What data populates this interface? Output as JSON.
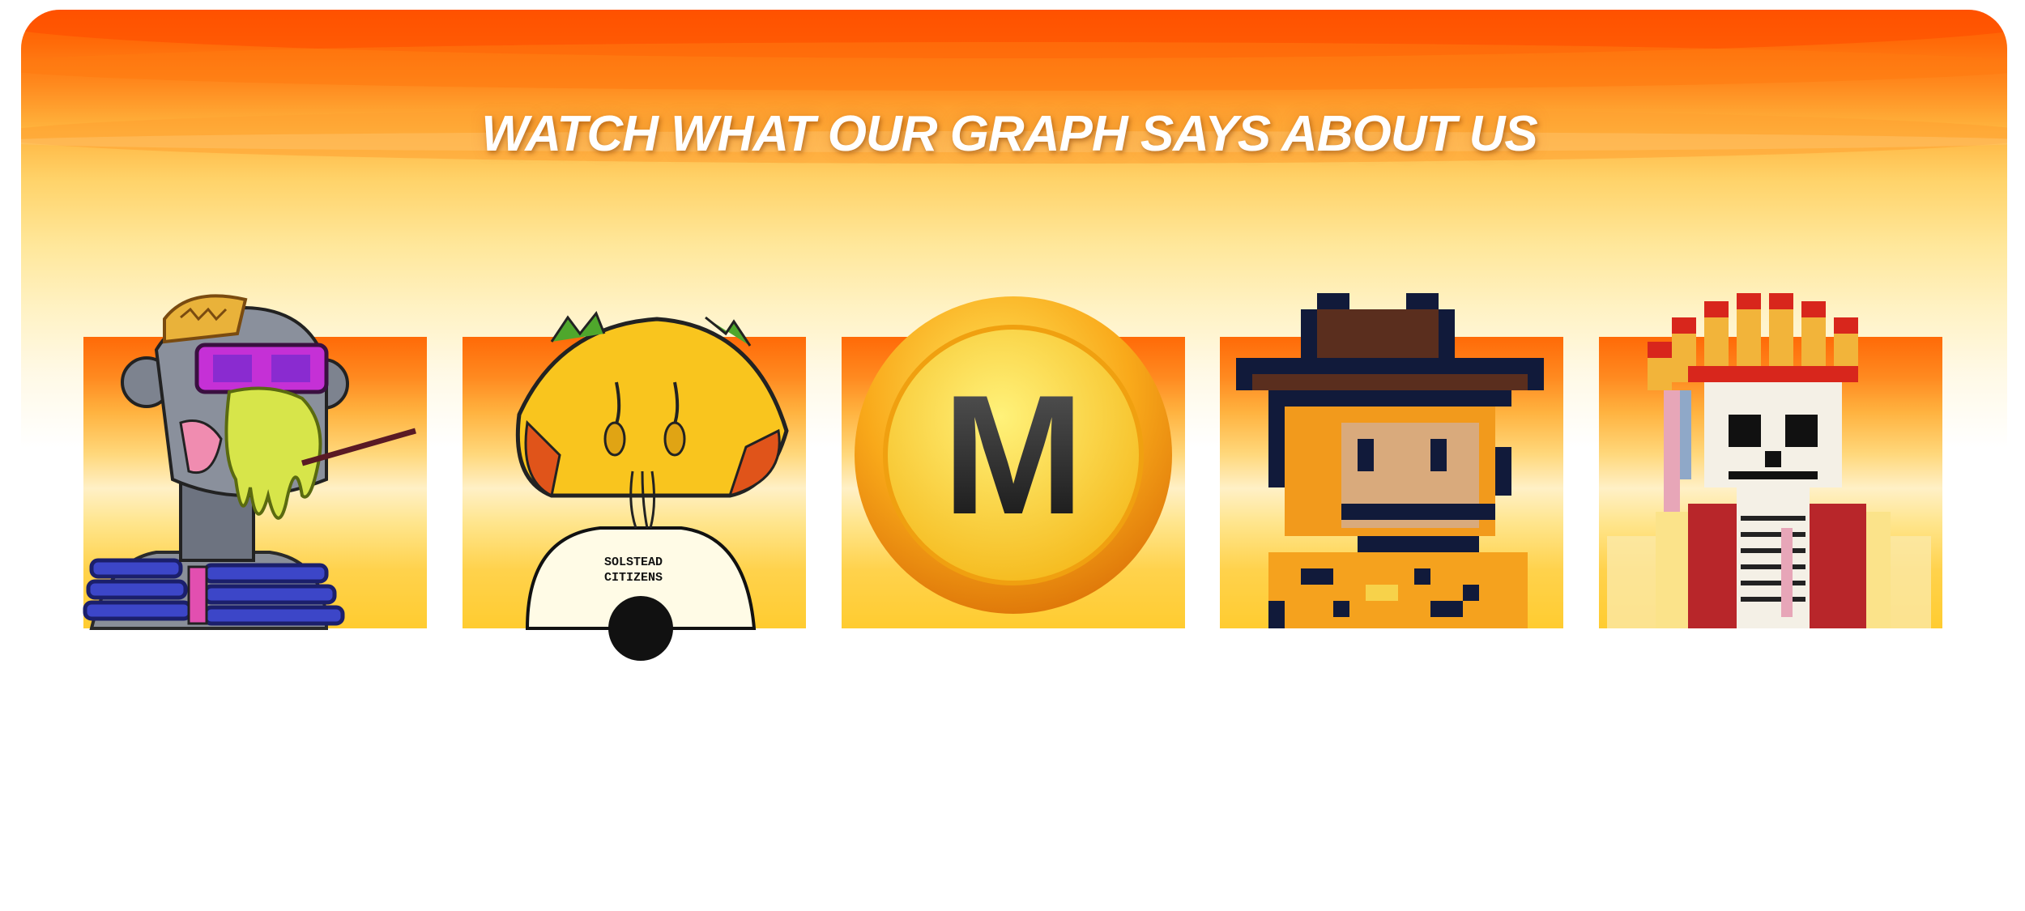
{
  "banner": {
    "title": "WATCH WHAT OUR GRAPH SAYS ABOUT US"
  },
  "nft_cards": [
    {
      "icon": "robot-ape-icon",
      "shirt_text": ""
    },
    {
      "icon": "taco-head-icon",
      "shirt_text": "SOLSTEAD CITIZENS"
    },
    {
      "icon": "gold-coin-m-icon",
      "coin_letter": "M"
    },
    {
      "icon": "pixel-cowboy-ape-icon"
    },
    {
      "icon": "pixel-skeleton-headdress-icon"
    }
  ],
  "colors": {
    "orange": "#ff5a00",
    "gold": "#ffcc30",
    "title_text": "#ffffff"
  }
}
